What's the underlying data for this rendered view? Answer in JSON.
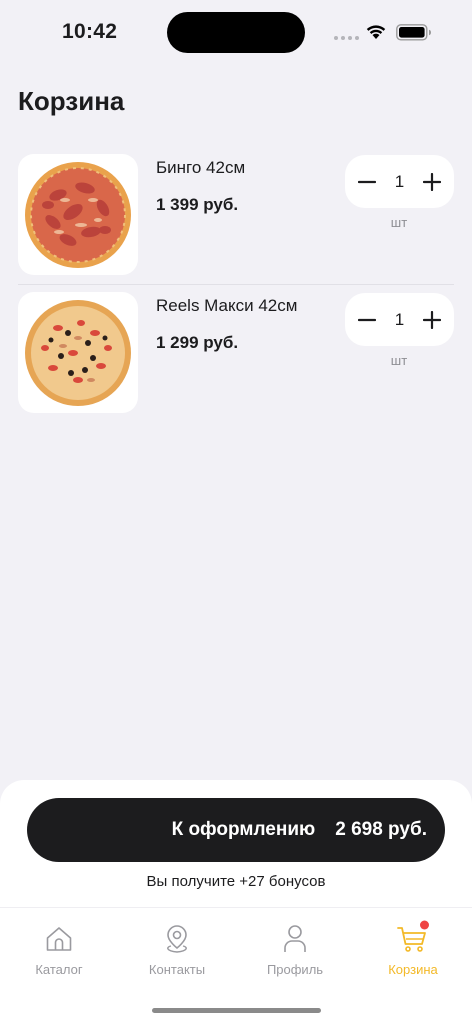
{
  "status_bar": {
    "time": "10:42"
  },
  "page_title": "Корзина",
  "cart": {
    "items": [
      {
        "name": "Бинго 42см",
        "price": "1 399 руб.",
        "quantity": "1",
        "unit": "шт",
        "image": "pizza-bingo-image"
      },
      {
        "name": "Reels Макси 42см",
        "price": "1 299 руб.",
        "quantity": "1",
        "unit": "шт",
        "image": "pizza-reels-maxi-image"
      }
    ]
  },
  "checkout": {
    "label": "К оформлению",
    "total": "2 698 руб."
  },
  "bonus_text": "Вы получите +27 бонусов",
  "tabs": [
    {
      "label": "Каталог",
      "icon": "home-icon",
      "active": false
    },
    {
      "label": "Контакты",
      "icon": "location-pin-icon",
      "active": false
    },
    {
      "label": "Профиль",
      "icon": "person-icon",
      "active": false
    },
    {
      "label": "Корзина",
      "icon": "cart-icon",
      "active": true,
      "badge": true
    }
  ],
  "colors": {
    "accent": "#f3b928",
    "badge": "#ef4444",
    "button": "#1c1c1e",
    "background": "#f2f1f6"
  }
}
